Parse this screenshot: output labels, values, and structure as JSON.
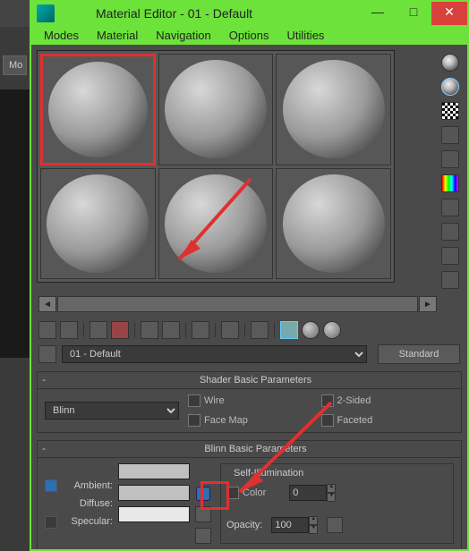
{
  "left_panel": {
    "mo_label": "Mo"
  },
  "window": {
    "title": "Material Editor - 01 - Default",
    "min": "—",
    "max": "□",
    "close": "✕"
  },
  "menu": {
    "modes": "Modes",
    "material": "Material",
    "navigation": "Navigation",
    "options": "Options",
    "utilities": "Utilities"
  },
  "scroll": {
    "left": "◄",
    "right": "►"
  },
  "name_row": {
    "material_name": "01 - Default",
    "type_button": "Standard"
  },
  "rollout1": {
    "title": "Shader Basic Parameters",
    "shader": "Blinn",
    "wire": "Wire",
    "two_sided": "2-Sided",
    "face_map": "Face Map",
    "faceted": "Faceted"
  },
  "rollout2": {
    "title": "Blinn Basic Parameters",
    "ambient": "Ambient:",
    "diffuse": "Diffuse:",
    "specular": "Specular:",
    "self_illum_group": "Self-Illumination",
    "color": "Color",
    "color_val": "0",
    "opacity": "Opacity:",
    "opacity_val": "100"
  }
}
